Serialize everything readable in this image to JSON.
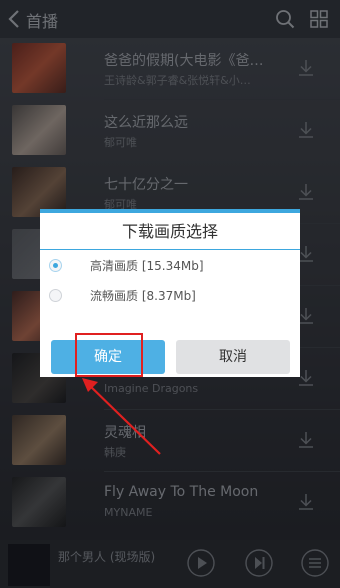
{
  "topbar": {
    "title": "首播"
  },
  "songs": [
    {
      "name": "爸爸的假期(大电影《爸…",
      "artist": "王诗龄&郭子睿&张悦轩&小…"
    },
    {
      "name": "这么近那么远",
      "artist": "郁可唯"
    },
    {
      "name": "七十亿分之一",
      "artist": "郁可唯"
    },
    {
      "name": "",
      "artist": ""
    },
    {
      "name": "",
      "artist": ""
    },
    {
      "name": "",
      "artist": "Imagine Dragons"
    },
    {
      "name": "灵魂相",
      "artist": "韩庚"
    },
    {
      "name": "Fly Away To The Moon",
      "artist": "MYNAME"
    }
  ],
  "dialog": {
    "title": "下载画质选择",
    "options": [
      {
        "label": "高清画质 [15.34Mb]",
        "selected": true
      },
      {
        "label": "流畅画质 [8.37Mb]",
        "selected": false
      }
    ],
    "ok_label": "确定",
    "cancel_label": "取消"
  },
  "player": {
    "title": "那个男人 (现场版)",
    "subtitle": ""
  },
  "colors": {
    "accent": "#3da7de",
    "highlight": "#e02020"
  }
}
